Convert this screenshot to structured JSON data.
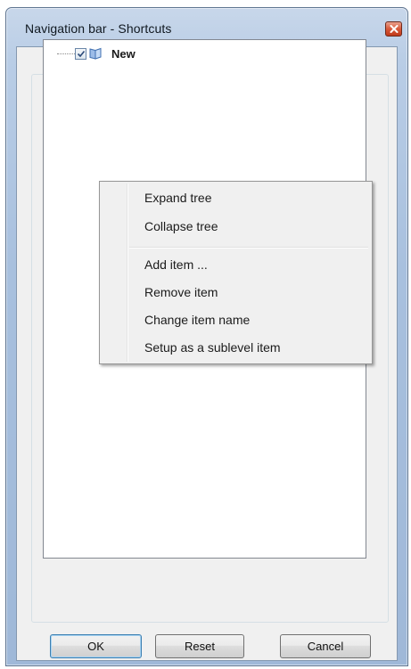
{
  "window": {
    "title": "Navigation bar - Shortcuts"
  },
  "tree": {
    "nodes": [
      {
        "label": "New",
        "checked": true,
        "icon": "book-icon"
      }
    ]
  },
  "context_menu": {
    "items": [
      {
        "label": "Expand tree"
      },
      {
        "label": "Collapse tree"
      },
      {
        "label": "Add item ..."
      },
      {
        "label": "Remove item"
      },
      {
        "label": "Change item name"
      },
      {
        "label": "Setup as a sublevel item"
      }
    ]
  },
  "buttons": {
    "ok_label": "OK",
    "reset_label": "Reset",
    "cancel_label": "Cancel"
  },
  "colors": {
    "title_bar": "#b9cde6",
    "close_button": "#d8593a",
    "dialog_bg": "#f0f0f0",
    "default_button_border": "#3c7fb1"
  }
}
